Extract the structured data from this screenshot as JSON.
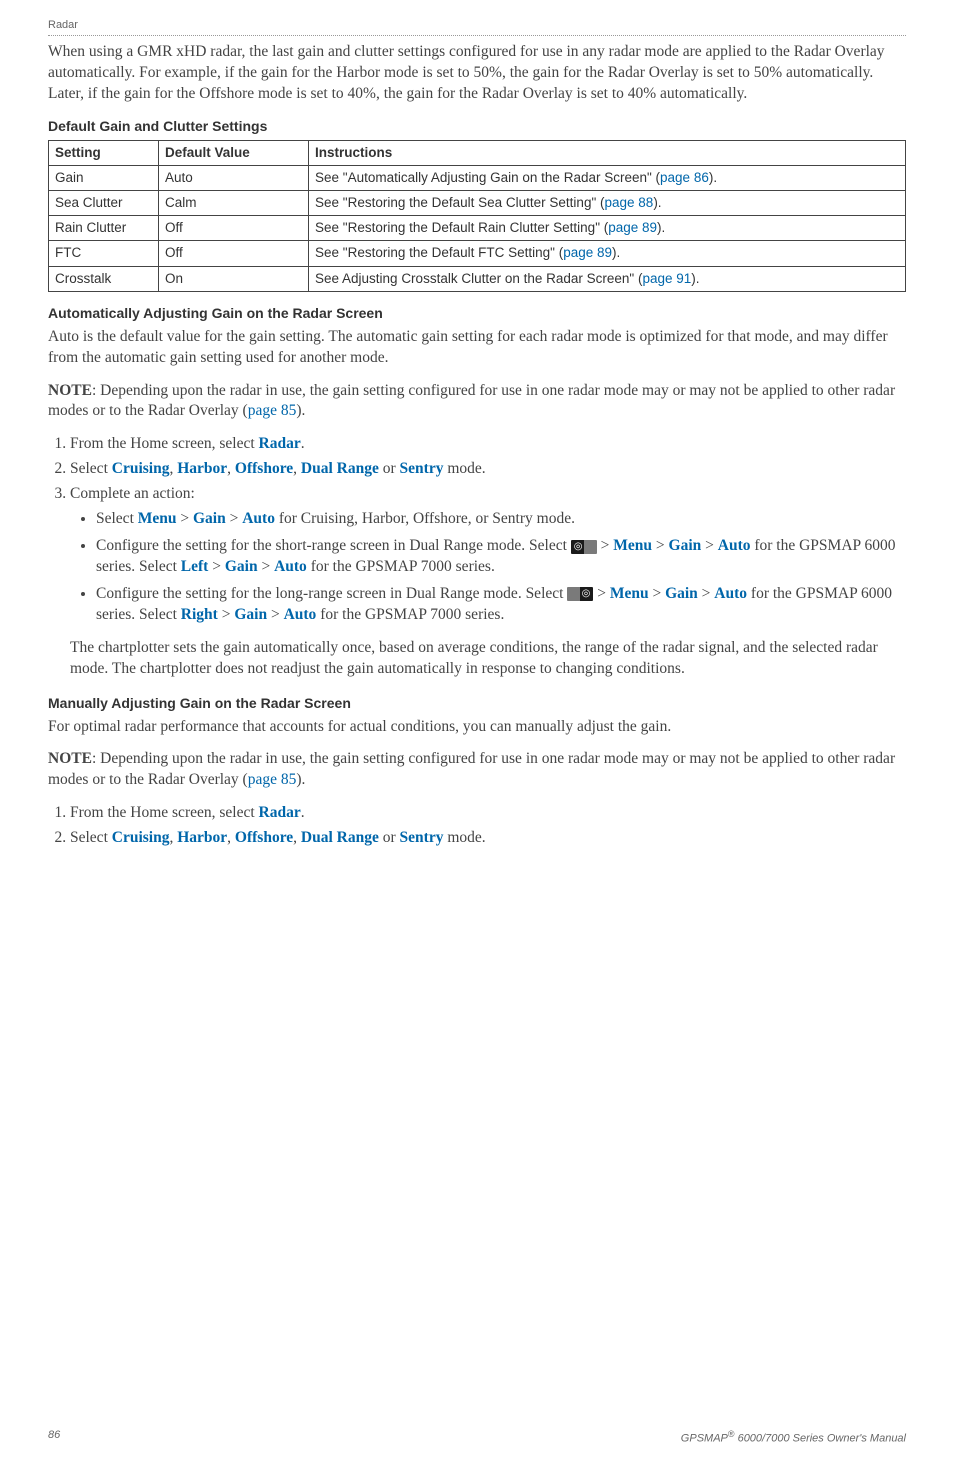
{
  "header": {
    "label": "Radar"
  },
  "intro": "When using a GMR xHD radar, the last gain and clutter settings configured for use in any radar mode are applied to the Radar Overlay automatically. For example, if the gain for the Harbor mode is set to 50%, the gain for the Radar Overlay is set to 50% automatically. Later, if the gain for the Offshore mode is set to 40%, the gain for the Radar Overlay is set to 40% automatically.",
  "table": {
    "title": "Default Gain and Clutter Settings",
    "headers": {
      "setting": "Setting",
      "default": "Default Value",
      "instructions": "Instructions"
    },
    "rows": [
      {
        "setting": "Gain",
        "default": "Auto",
        "instr_pre": "See \"Automatically Adjusting Gain on the Radar Screen\" (",
        "instr_link": "page 86",
        "instr_post": ")."
      },
      {
        "setting": "Sea Clutter",
        "default": "Calm",
        "instr_pre": "See \"Restoring the Default Sea Clutter Setting\" (",
        "instr_link": "page 88",
        "instr_post": ")."
      },
      {
        "setting": "Rain Clutter",
        "default": "Off",
        "instr_pre": "See \"Restoring the Default Rain Clutter Setting\" (",
        "instr_link": "page 89",
        "instr_post": ")."
      },
      {
        "setting": "FTC",
        "default": "Off",
        "instr_pre": "See \"Restoring the Default FTC Setting\" (",
        "instr_link": "page 89",
        "instr_post": ")."
      },
      {
        "setting": "Crosstalk",
        "default": "On",
        "instr_pre": "See Adjusting Crosstalk Clutter on the Radar Screen\" (",
        "instr_link": "page 91",
        "instr_post": ")."
      }
    ]
  },
  "auto": {
    "title": "Automatically Adjusting Gain on the Radar Screen",
    "desc": "Auto is the default value for the gain setting. The automatic gain setting for each radar mode is optimized for that mode, and may differ from the automatic gain setting used for another mode.",
    "note_label": "NOTE",
    "note_body_pre": ": Depending upon the radar in use, the gain setting configured for use in one radar mode may or may not be applied to other radar modes or to the Radar Overlay (",
    "note_link": "page 85",
    "note_body_post": ").",
    "steps": {
      "s1_pre": "From the Home screen, select ",
      "s1_link": "Radar",
      "s1_post": ".",
      "s2_pre": "Select ",
      "s2_cruising": "Cruising",
      "s2_harbor": "Harbor",
      "s2_offshore": "Offshore",
      "s2_dual": "Dual Range",
      "s2_or": " or ",
      "s2_sentry": "Sentry",
      "s2_post": " mode.",
      "s3": "Complete an action:",
      "b1_pre": "Select ",
      "b1_menu": "Menu",
      "b1_gt": " > ",
      "b1_gain": "Gain",
      "b1_auto": "Auto",
      "b1_post": " for Cruising, Harbor, Offshore, or Sentry mode.",
      "b2_pre": "Configure the setting for the short-range screen in Dual Range mode. Select ",
      "b2_icon": "◎",
      "b2_gt": " > ",
      "b2_menu": "Menu",
      "b2_gain": "Gain",
      "b2_auto": "Auto",
      "b2_mid": " for the GPSMAP 6000 series. Select ",
      "b2_left": "Left",
      "b2_post": " for the GPSMAP 7000 series.",
      "b3_pre": "Configure the setting for the long-range screen in Dual Range mode. Select ",
      "b3_icon": "◎",
      "b3_gt": " > ",
      "b3_menu": "Menu",
      "b3_gain": "Gain",
      "b3_auto": "Auto",
      "b3_mid": " for the GPSMAP 6000 series. Select ",
      "b3_right": "Right",
      "b3_post": " for the GPSMAP 7000 series."
    },
    "closing": "The chartplotter sets the gain automatically once, based on average conditions, the range of the radar signal, and the selected radar mode. The chartplotter does not readjust the gain automatically in response to changing conditions."
  },
  "manual": {
    "title": "Manually Adjusting Gain on the Radar Screen",
    "desc": "For optimal radar performance that accounts for actual conditions, you can manually adjust the gain.",
    "note_label": "NOTE",
    "note_body_pre": ": Depending upon the radar in use, the gain setting configured for use in one radar mode may or may not be applied to other radar modes or to the Radar Overlay (",
    "note_link": "page 85",
    "note_body_post": ").",
    "steps": {
      "s1_pre": "From the Home screen, select ",
      "s1_link": "Radar",
      "s1_post": ".",
      "s2_pre": "Select ",
      "s2_cruising": "Cruising",
      "s2_harbor": "Harbor",
      "s2_offshore": "Offshore",
      "s2_dual": "Dual Range",
      "s2_or": " or ",
      "s2_sentry": "Sentry",
      "s2_post": " mode."
    }
  },
  "footer": {
    "page": "86",
    "product_pre": "GPSMAP",
    "product_post": " 6000/7000 Series Owner's Manual"
  }
}
